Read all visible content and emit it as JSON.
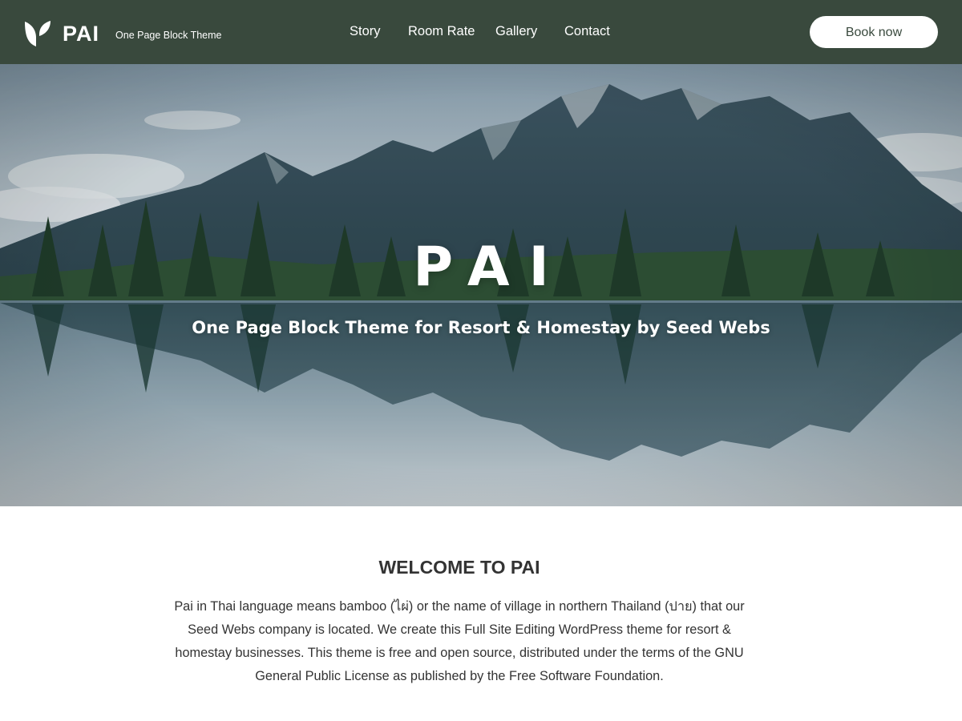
{
  "header": {
    "site_title": "PAI",
    "tagline": "One Page Block Theme",
    "nav": [
      {
        "label": "Story"
      },
      {
        "label": "Room Rate"
      },
      {
        "label": "Gallery"
      },
      {
        "label": "Contact"
      }
    ],
    "book_button": "Book now",
    "logo_icon": "leaf-icon"
  },
  "hero": {
    "title": "PAI",
    "subtitle": "One Page Block Theme for Resort & Homestay by Seed Webs"
  },
  "welcome": {
    "heading": "WELCOME TO PAI",
    "body": "Pai in Thai language means bamboo (ไผ่) or the name of village in northern Thailand (ปาย) that our Seed Webs company is located. We create this Full Site Editing WordPress theme for resort & homestay businesses. This theme is free and open source, distributed under the terms of the GNU General Public License as published by the Free Software Foundation."
  },
  "colors": {
    "header_bg": "#39493d",
    "button_bg": "#ffffff",
    "button_text": "#39493d",
    "text_dark": "#333333"
  }
}
